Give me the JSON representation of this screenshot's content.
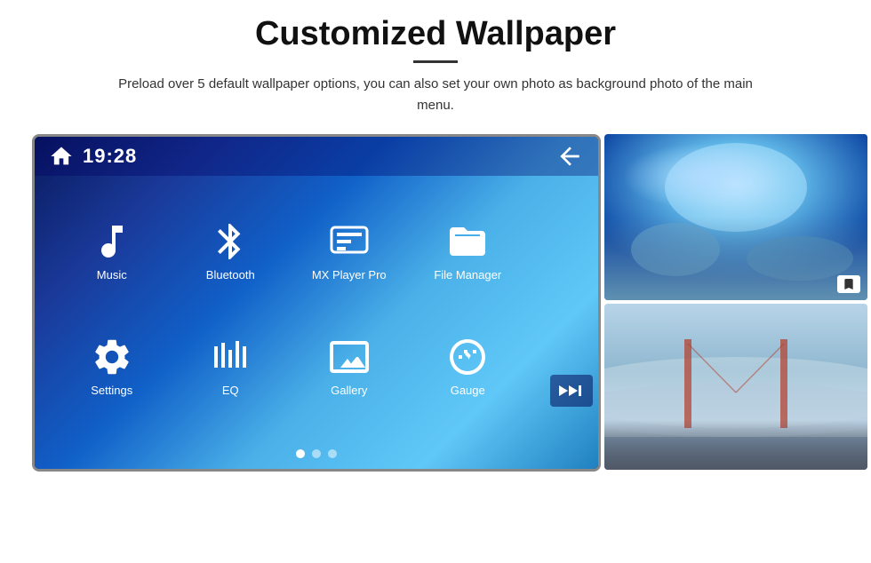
{
  "page": {
    "title": "Customized Wallpaper",
    "description": "Preload over 5 default wallpaper options, you can also set your own photo as background photo of the main menu."
  },
  "screen": {
    "time": "19:28",
    "apps_row1": [
      {
        "id": "music",
        "label": "Music"
      },
      {
        "id": "bluetooth",
        "label": "Bluetooth"
      },
      {
        "id": "mxplayer",
        "label": "MX Player Pro"
      },
      {
        "id": "filemanager",
        "label": "File Manager"
      }
    ],
    "apps_row2": [
      {
        "id": "settings",
        "label": "Settings"
      },
      {
        "id": "eq",
        "label": "EQ"
      },
      {
        "id": "gallery",
        "label": "Gallery"
      },
      {
        "id": "gauge",
        "label": "Gauge"
      }
    ],
    "dots": [
      true,
      false,
      false
    ]
  },
  "images": {
    "image1_alt": "Ice cave wallpaper",
    "image2_alt": "Golden Gate Bridge fog wallpaper"
  }
}
